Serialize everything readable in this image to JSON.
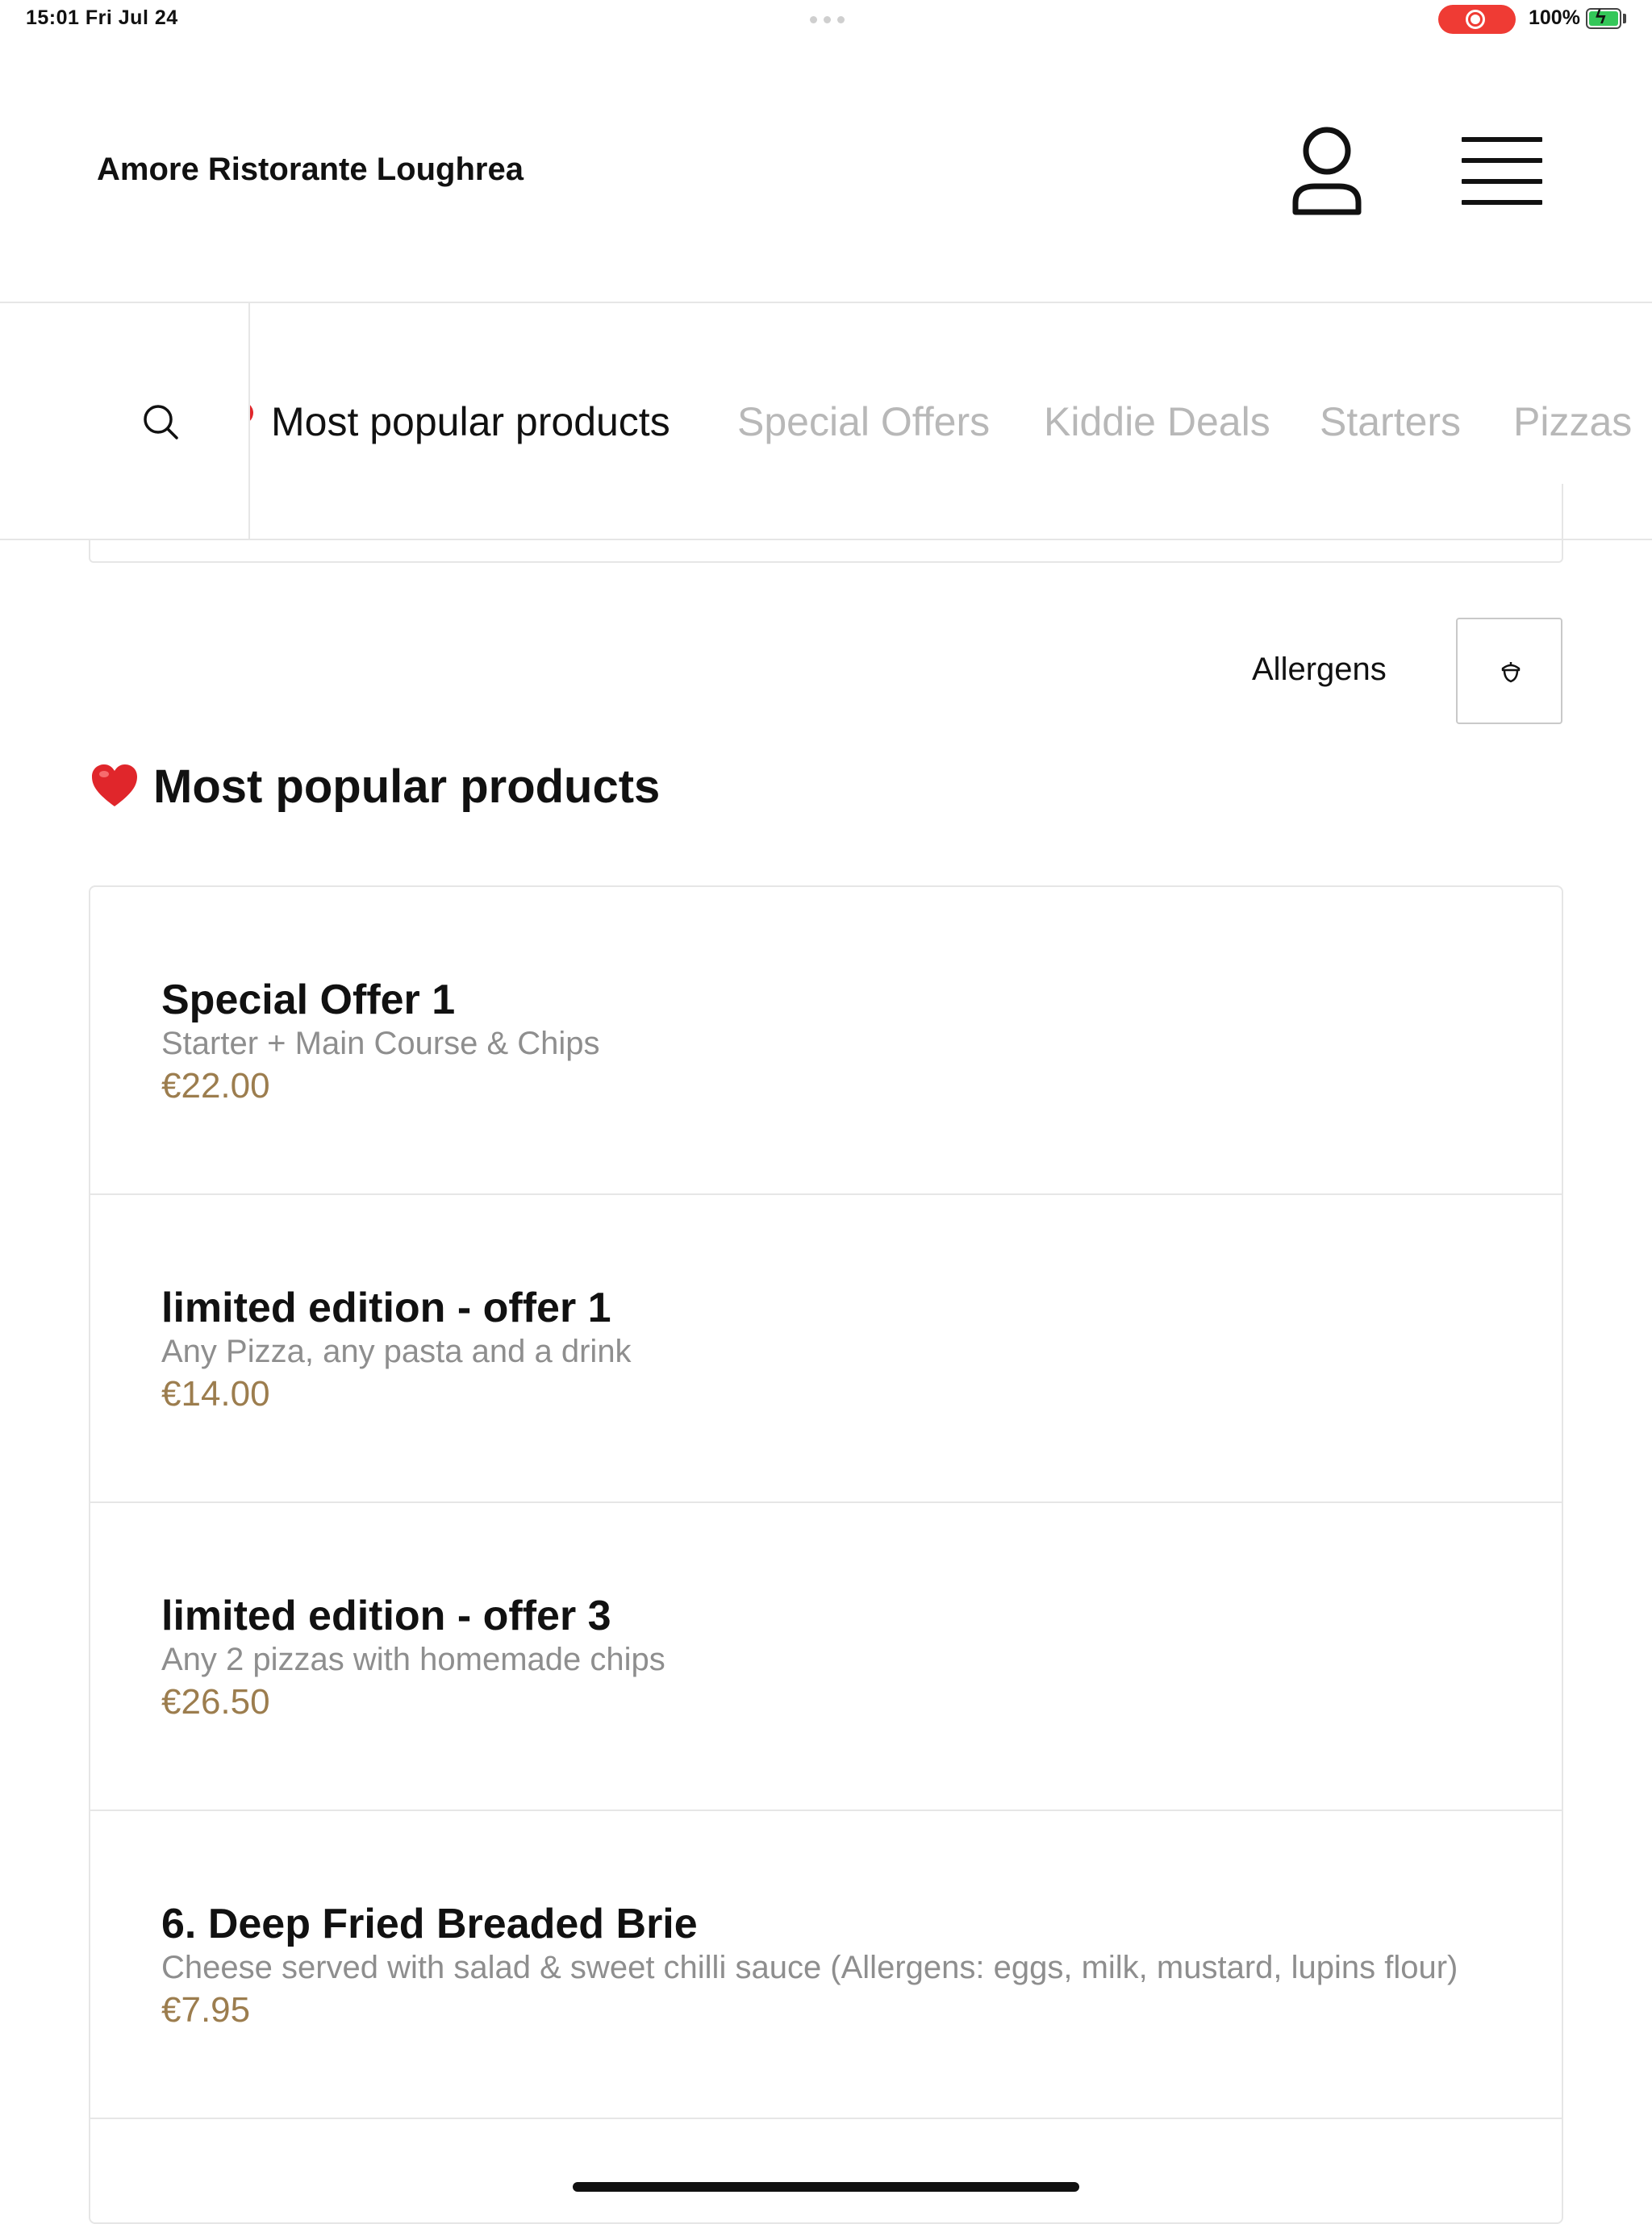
{
  "status_bar": {
    "time_date": "15:01   Fri Jul 24",
    "battery": "100%",
    "colors": {
      "record": "#ef3b34",
      "battery": "#34c759"
    }
  },
  "header": {
    "restaurant_name": "Amore Ristorante Loughrea",
    "icons": [
      "account-icon",
      "menu-icon"
    ]
  },
  "nav": {
    "search_icon": "search-icon",
    "tabs": [
      {
        "label": "Most popular products",
        "active": true
      },
      {
        "label": "Special Offers"
      },
      {
        "label": "Kiddie Deals"
      },
      {
        "label": "Starters"
      },
      {
        "label": "Pizzas"
      }
    ]
  },
  "allergens": {
    "label": "Allergens",
    "icon": "acorn-icon"
  },
  "section": {
    "title": "Most popular products",
    "icon": "heart-icon",
    "accent": "#e0262b"
  },
  "products": [
    {
      "name": "Special Offer 1",
      "description": "Starter + Main Course & Chips",
      "price": "€22.00"
    },
    {
      "name": "limited edition - offer 1",
      "description": "Any Pizza, any pasta and a drink",
      "price": "€14.00"
    },
    {
      "name": "limited edition - offer 3",
      "description": "Any 2 pizzas with homemade chips",
      "price": "€26.50"
    },
    {
      "name": "6. Deep Fried Breaded Brie",
      "description": "Cheese served with salad & sweet chilli sauce (Allergens: eggs, milk, mustard, lupins flour)",
      "price": "€7.95"
    }
  ],
  "colors": {
    "price": "#9c7d4e",
    "description": "#8e8e8e",
    "inactive_tab": "#b8b8b8"
  }
}
